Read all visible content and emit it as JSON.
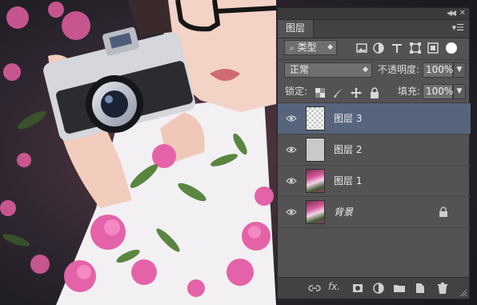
{
  "panel": {
    "tab_label": "图层"
  },
  "filter_row": {
    "kind_label": "类型",
    "icons": [
      "image-filter-icon",
      "adjustment-filter-icon",
      "type-filter-icon",
      "shape-filter-icon",
      "smart-object-filter-icon"
    ]
  },
  "blend_row": {
    "mode": "正常",
    "opacity_label": "不透明度:",
    "opacity_value": "100%"
  },
  "lock_row": {
    "lock_label": "锁定:",
    "fill_label": "填充:",
    "fill_value": "100%"
  },
  "layers": [
    {
      "name": "图层 3",
      "thumb": "transparent",
      "selected": true,
      "visible": true
    },
    {
      "name": "图层 2",
      "thumb": "gray",
      "selected": false,
      "visible": true
    },
    {
      "name": "图层 1",
      "thumb": "photo",
      "selected": false,
      "visible": true
    },
    {
      "name": "背景",
      "thumb": "photo",
      "selected": false,
      "visible": true,
      "locked": true
    }
  ],
  "footer_icons": [
    "link-layers-icon",
    "fx-icon",
    "add-mask-icon",
    "adjustment-layer-icon",
    "new-group-icon",
    "new-layer-icon",
    "delete-layer-icon"
  ],
  "footer_fx_label": "fx.",
  "colors": {
    "panel_bg": "#535353",
    "selected_row": "#56657d",
    "field_bg": "#6f6f6f"
  }
}
